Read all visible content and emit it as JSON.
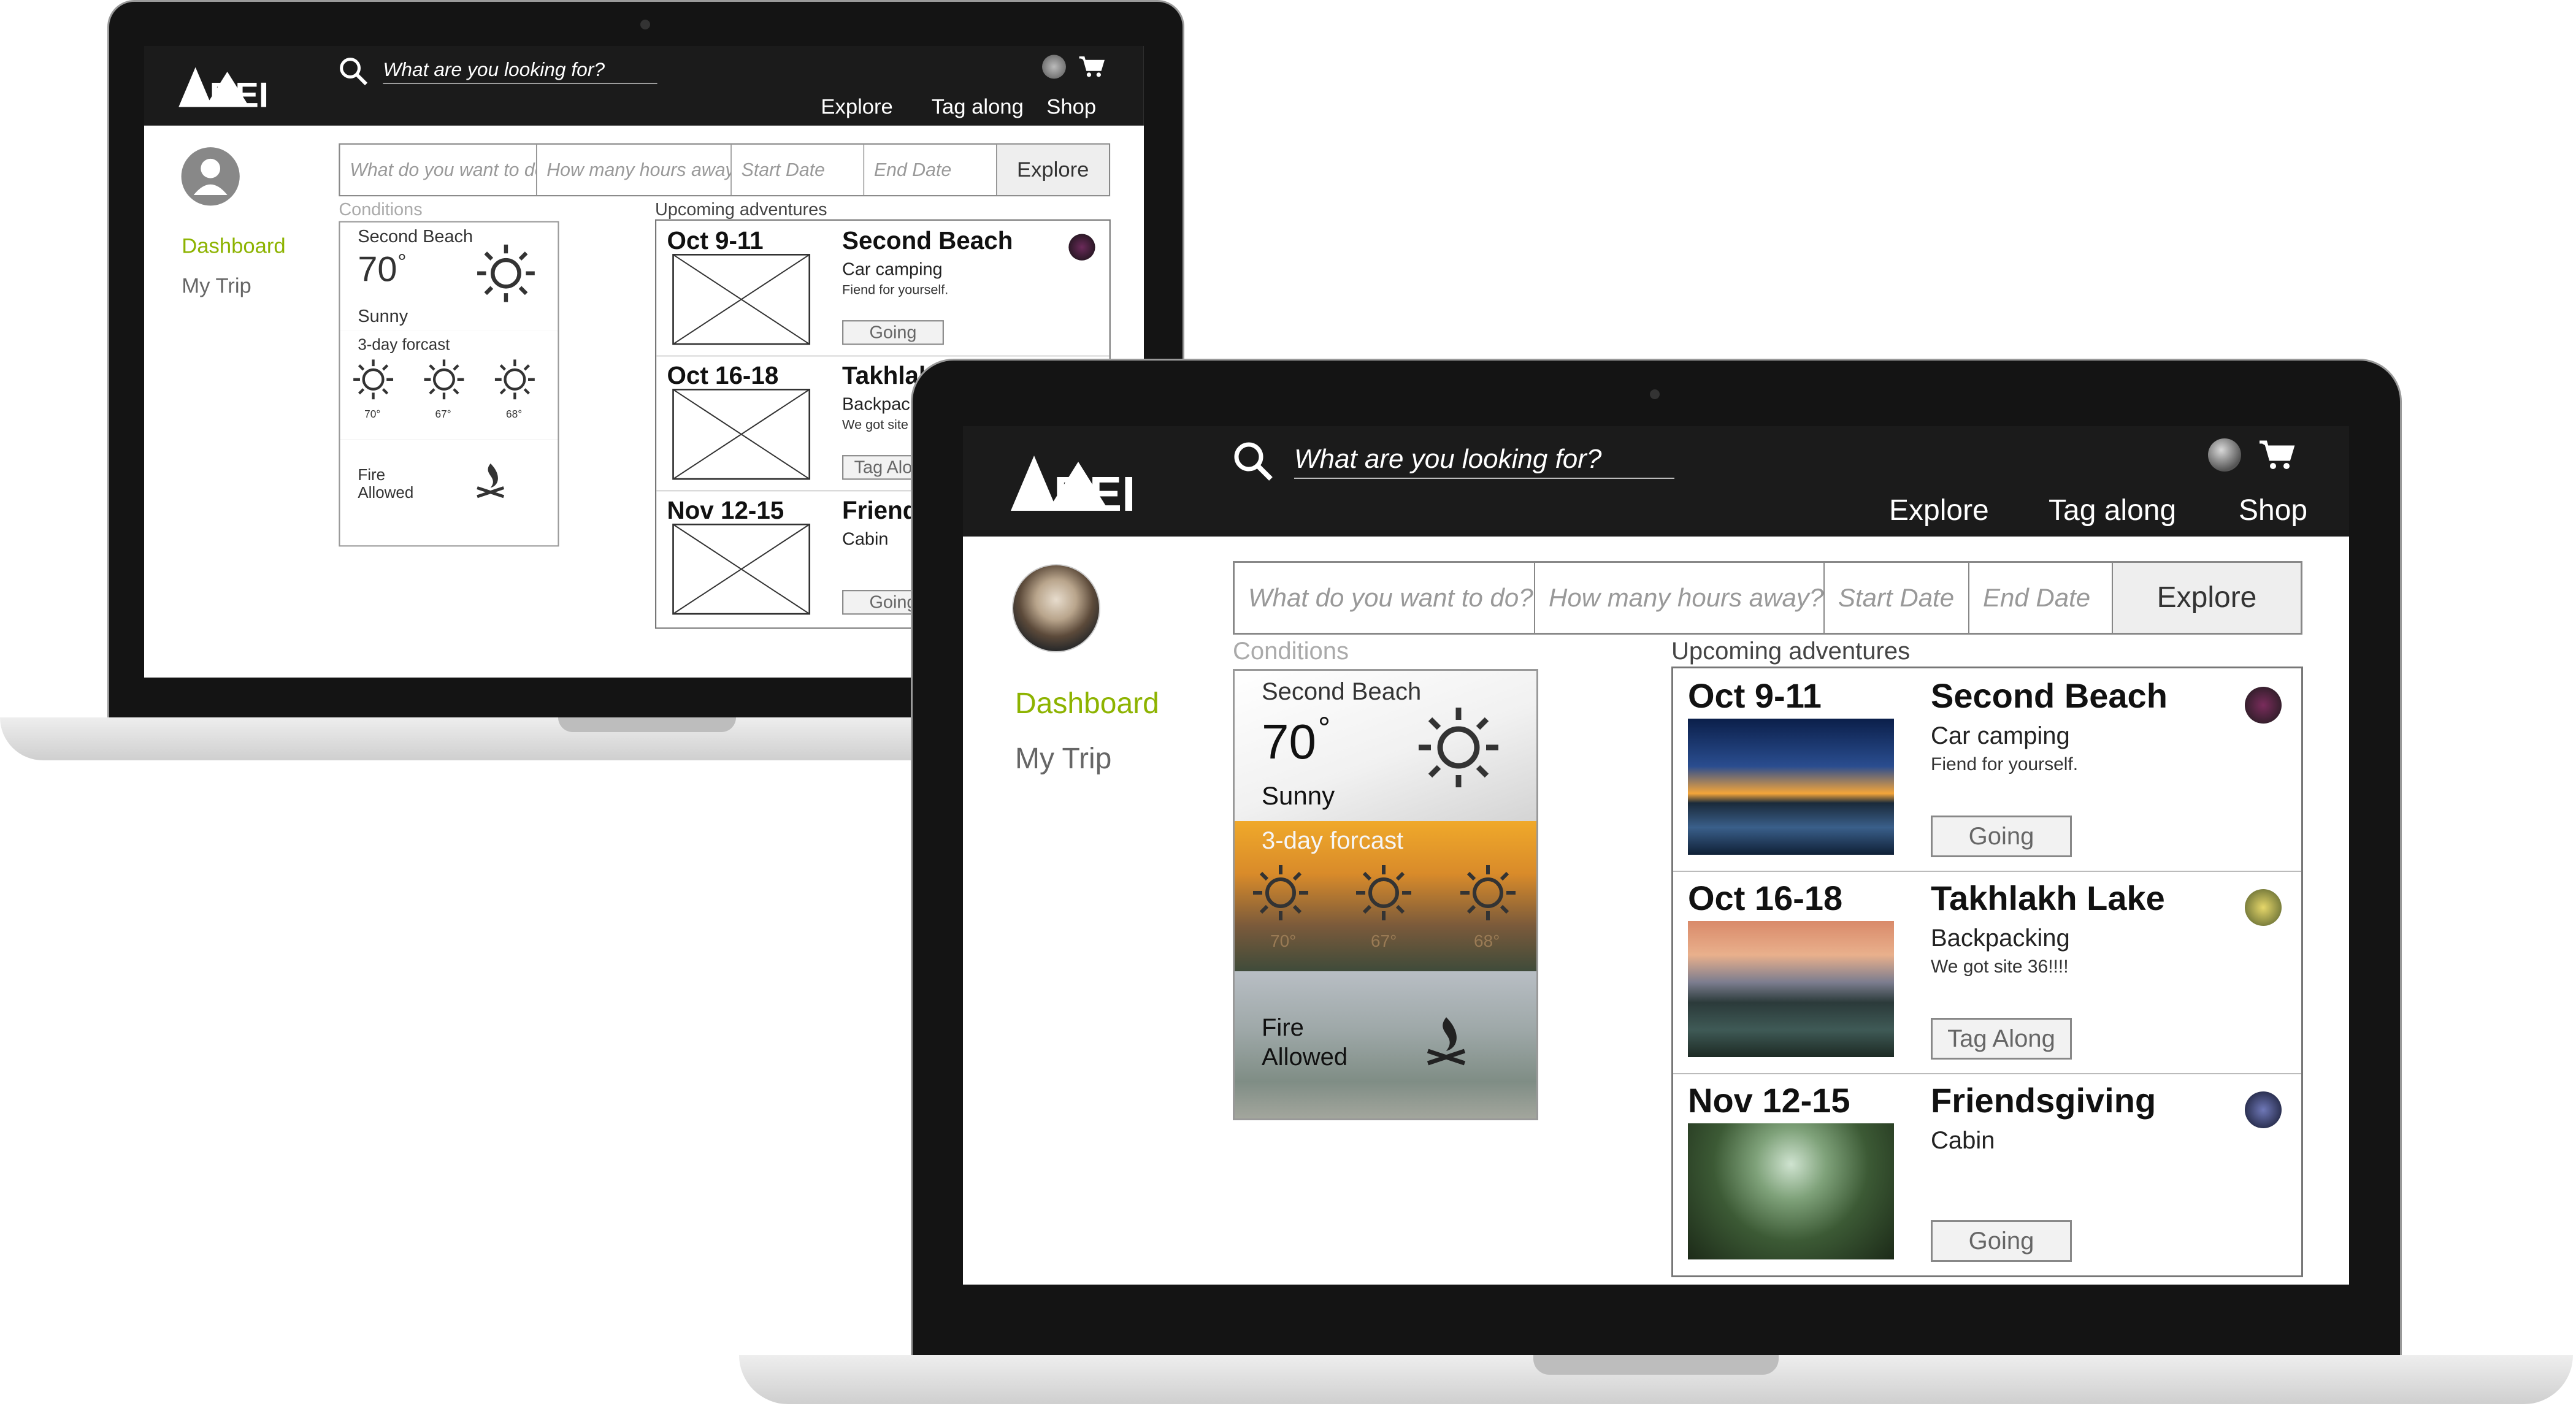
{
  "header": {
    "brand": "REI",
    "search_placeholder": "What are you looking for?",
    "nav": [
      "Explore",
      "Tag along",
      "Shop"
    ]
  },
  "sidebar": {
    "items": [
      "Dashboard",
      "My Trip"
    ],
    "active_color": "#8db300"
  },
  "filters": {
    "activity": "What do you want to do?",
    "hours": "How many hours away?",
    "start": "Start Date",
    "end": "End Date",
    "button": "Explore"
  },
  "conditions": {
    "label": "Conditions",
    "location": "Second Beach",
    "temp": "70",
    "deg": "°",
    "sky": "Sunny",
    "forecast_label": "3-day forcast",
    "forecast": [
      "70°",
      "67°",
      "68°"
    ],
    "fire_line1": "Fire",
    "fire_line2": "Allowed"
  },
  "adventures": {
    "label": "Upcoming adventures",
    "items": [
      {
        "date": "Oct 9-11",
        "name": "Second Beach",
        "type": "Car camping",
        "note": "Fiend for yourself.",
        "button": "Going"
      },
      {
        "date": "Oct 16-18",
        "name": "Takhlakh Lake",
        "type": "Backpacking",
        "note": "We got site 36!!!!",
        "button": "Tag Along"
      },
      {
        "date": "Nov 12-15",
        "name": "Friendsgiving",
        "type": "Cabin",
        "note": "",
        "button": "Going"
      }
    ]
  },
  "icons": [
    "search-icon",
    "user-icon",
    "cart-icon",
    "sun-icon",
    "campfire-icon"
  ]
}
